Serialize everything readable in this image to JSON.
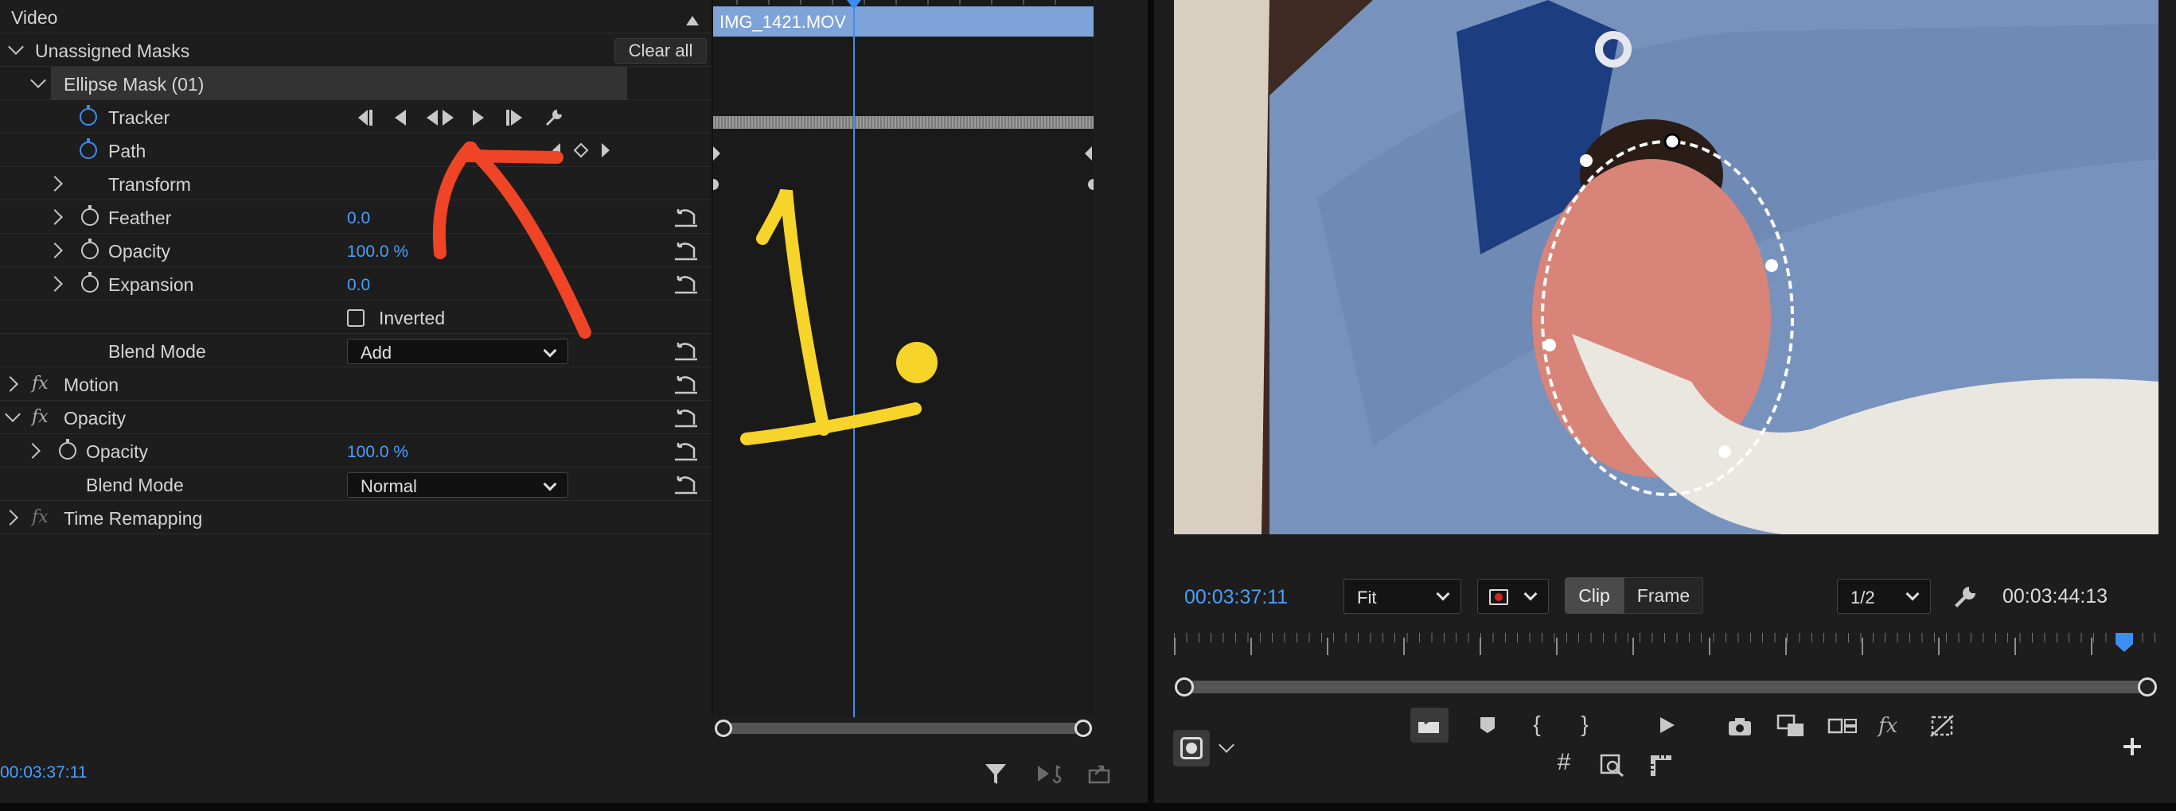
{
  "effect_controls": {
    "section_video": "Video",
    "unassigned_masks": "Unassigned Masks",
    "clear_all": "Clear all",
    "ellipse_mask": "Ellipse Mask (01)",
    "tracker_label": "Tracker",
    "path_label": "Path",
    "transform_label": "Transform",
    "feather_label": "Feather",
    "feather_value": "0.0",
    "opacity_label": "Opacity",
    "opacity_value": "100.0 %",
    "expansion_label": "Expansion",
    "expansion_value": "0.0",
    "inverted_label": "Inverted",
    "blend_mode_label": "Blend Mode",
    "blend_mode_value": "Add",
    "motion_label": "Motion",
    "opacity_section_label": "Opacity",
    "opacity2_label": "Opacity",
    "opacity2_value": "100.0 %",
    "blend_mode2_label": "Blend Mode",
    "blend_mode2_value": "Normal",
    "time_remap_label": "Time Remapping",
    "fx_glyph": "fx",
    "timecode": "00:03:37:11"
  },
  "timeline": {
    "clip_name": "IMG_1421.MOV"
  },
  "annotation": {
    "handwritten_text": "1."
  },
  "program_monitor": {
    "current_time": "00:03:37:11",
    "zoom": "Fit",
    "clip_btn": "Clip",
    "frame_btn": "Frame",
    "resolution": "1/2",
    "duration": "00:03:44:13"
  },
  "colors": {
    "accent_blue": "#4b9ffc",
    "annotation_red": "#ef4426",
    "annotation_yellow": "#f7d42a",
    "clip_bar": "#7da3d8"
  },
  "icons": [
    "wrench-icon",
    "camera-icon",
    "fx-icon",
    "filter-icon",
    "plus-icon",
    "play-icon",
    "marker-icon"
  ]
}
